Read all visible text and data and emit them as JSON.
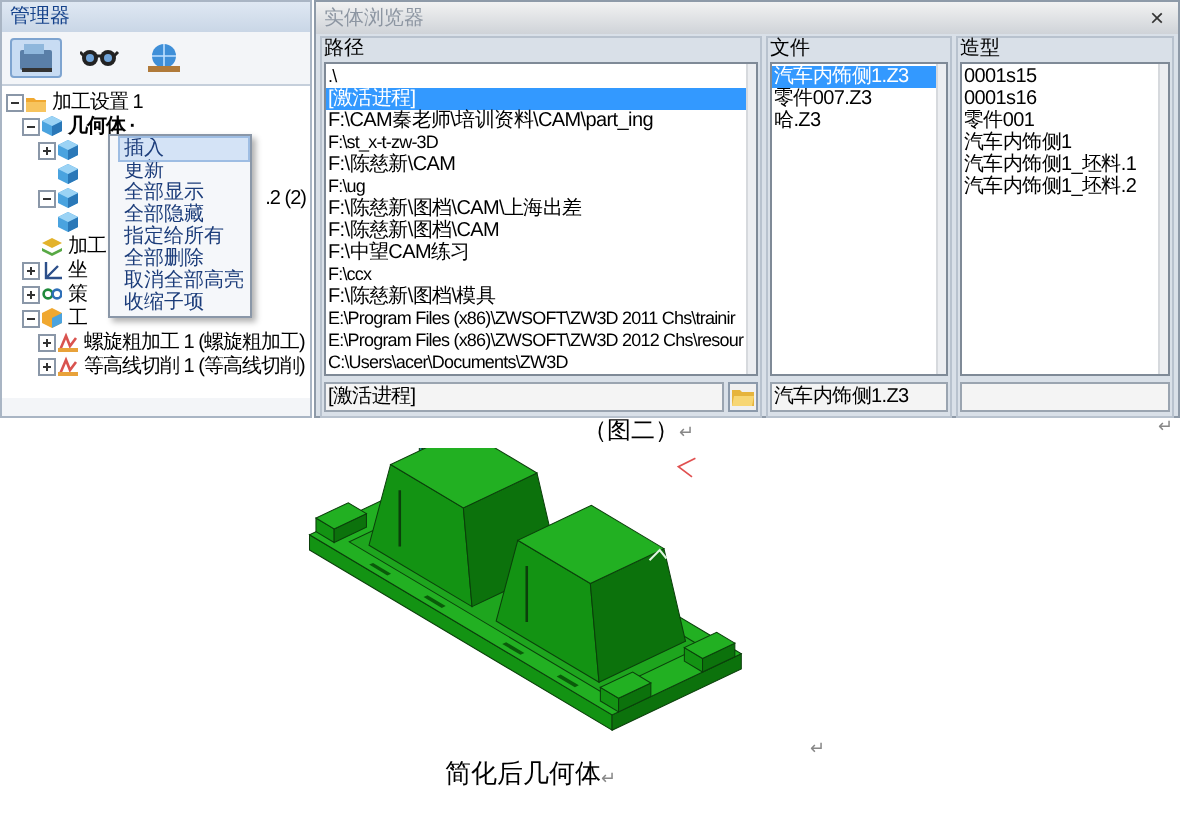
{
  "manager": {
    "title": "管理器",
    "tabs": [
      {
        "kind": "cam",
        "selected": true
      },
      {
        "kind": "glasses",
        "selected": false
      },
      {
        "kind": "globe",
        "selected": false
      }
    ],
    "tree": [
      {
        "label": "加工设置 1",
        "kind": "folder",
        "selected": false,
        "expanded": true,
        "children": [
          {
            "label": "几何体 ·",
            "kind": "cube",
            "selected": true,
            "expanded": true,
            "children": [
              {
                "kind": "cube",
                "selected": false,
                "expanded": false
              },
              {
                "kind": "cube",
                "selected": false
              },
              {
                "label": ".2 (2)",
                "kind": "cube",
                "selected": false,
                "expanded": true,
                "covered": true
              },
              {
                "kind": "cube",
                "selected": false
              }
            ]
          },
          {
            "label": "加工",
            "kind": "layers",
            "selected": false
          },
          {
            "label": "坐",
            "kind": "axes",
            "selected": false,
            "expanded": false
          },
          {
            "label": "策",
            "kind": "chain",
            "selected": false,
            "expanded": false
          },
          {
            "label": "工",
            "kind": "tool",
            "selected": false,
            "expanded": true,
            "children": [
              {
                "label": "螺旋粗加工 1 (螺旋粗加工)",
                "kind": "operation",
                "selected": false,
                "expanded": false
              },
              {
                "label": "等高线切削 1 (等高线切削)",
                "kind": "operation",
                "selected": false,
                "expanded": false
              }
            ]
          }
        ]
      }
    ],
    "context_menu": [
      {
        "label": "插入",
        "selected": true
      },
      {
        "label": "更新",
        "selected": false
      },
      {
        "label": "全部显示",
        "selected": false
      },
      {
        "label": "全部隐藏",
        "selected": false
      },
      {
        "label": "指定给所有",
        "selected": false
      },
      {
        "label": "全部删除",
        "selected": false
      },
      {
        "label": "取消全部高亮",
        "selected": false
      },
      {
        "label": "收缩子项",
        "selected": false
      }
    ]
  },
  "dialog": {
    "title": "实体浏览器",
    "close": "×",
    "columns": [
      {
        "kind": "path",
        "header": "路径",
        "field": "[激活进程]",
        "items": [
          {
            "text": ".\\",
            "selected": false
          },
          {
            "text": "[激活进程]",
            "selected": true
          },
          {
            "text": "F:\\CAM秦老师\\培训资料\\CAM\\part_ing",
            "selected": false
          },
          {
            "text": "F:\\st_x-t-zw-3D",
            "selected": false
          },
          {
            "text": "F:\\陈慈新\\CAM",
            "selected": false
          },
          {
            "text": "F:\\ug",
            "selected": false
          },
          {
            "text": "F:\\陈慈新\\图档\\CAM\\上海出差",
            "selected": false
          },
          {
            "text": "F:\\陈慈新\\图档\\CAM",
            "selected": false
          },
          {
            "text": "F:\\中望CAM练习",
            "selected": false
          },
          {
            "text": "F:\\ccx",
            "selected": false
          },
          {
            "text": "F:\\陈慈新\\图档\\模具",
            "selected": false
          },
          {
            "text": "E:\\Program Files (x86)\\ZWSOFT\\ZW3D 2011 Chs\\trainir",
            "selected": false
          },
          {
            "text": "E:\\Program Files (x86)\\ZWSOFT\\ZW3D 2012 Chs\\resour",
            "selected": false
          },
          {
            "text": "C:\\Users\\acer\\Documents\\ZW3D",
            "selected": false
          }
        ]
      },
      {
        "kind": "file",
        "header": "文件",
        "field": "汽车内饰侧1.Z3",
        "items": [
          {
            "text": "汽车内饰侧1.Z3",
            "selected": true
          },
          {
            "text": "零件007.Z3",
            "selected": false
          },
          {
            "text": "哈.Z3",
            "selected": false
          }
        ]
      },
      {
        "kind": "model",
        "header": "造型",
        "items": [
          {
            "text": "0001s15",
            "selected": false
          },
          {
            "text": "0001s16",
            "selected": false
          },
          {
            "text": "零件001",
            "selected": false
          },
          {
            "text": "汽车内饰侧1",
            "selected": false
          },
          {
            "text": "汽车内饰侧1_坯料.1",
            "selected": false
          },
          {
            "text": "汽车内饰侧1_坯料.2",
            "selected": false
          }
        ]
      }
    ]
  },
  "screenshot_end_mark": "↵",
  "caption_1": {
    "text": "（图二）",
    "mark": "↵"
  },
  "model_end_mark": "↵",
  "caption_2": {
    "text": "简化后几何体",
    "mark": "↵"
  }
}
